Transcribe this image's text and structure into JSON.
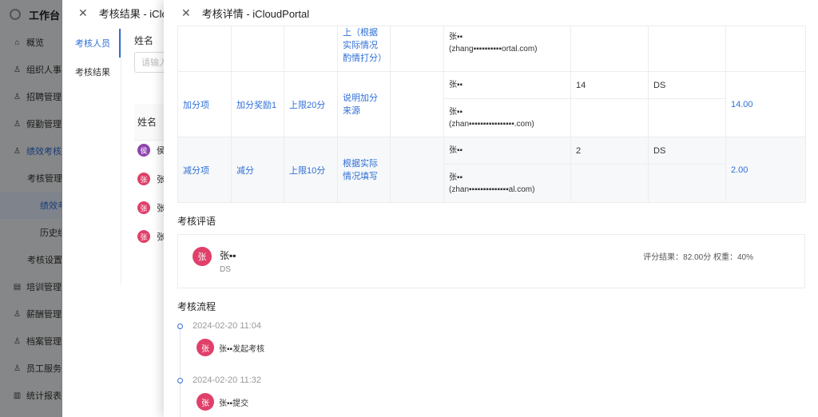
{
  "app": {
    "brand": "工作台",
    "nav": [
      {
        "label": "概览",
        "icon": "home-icon",
        "level": 0
      },
      {
        "label": "组织人事",
        "icon": "people-icon",
        "level": 0
      },
      {
        "label": "招聘管理",
        "icon": "people-icon",
        "level": 0
      },
      {
        "label": "假勤管理",
        "icon": "people-icon",
        "level": 0
      },
      {
        "label": "绩效考核",
        "icon": "people-icon",
        "level": 0
      },
      {
        "label": "考核管理",
        "icon": "",
        "level": 1
      },
      {
        "label": "绩效考核",
        "icon": "",
        "level": 2
      },
      {
        "label": "历史绩效",
        "icon": "",
        "level": 2
      },
      {
        "label": "考核设置",
        "icon": "",
        "level": 1
      },
      {
        "label": "培训管理",
        "icon": "book-icon",
        "level": 0
      },
      {
        "label": "薪酬管理",
        "icon": "people-icon",
        "level": 0
      },
      {
        "label": "档案管理",
        "icon": "people-icon",
        "level": 0
      },
      {
        "label": "员工服务",
        "icon": "people-icon",
        "level": 0
      },
      {
        "label": "统计报表",
        "icon": "chart-icon",
        "level": 0
      }
    ]
  },
  "drawer1": {
    "title": "考核结果 - iClou",
    "tabs": [
      "考核人员",
      "考核结果"
    ],
    "search_label": "姓名",
    "search_placeholder": "请输入",
    "column_name": "姓名",
    "rows": [
      {
        "avatar": "侯",
        "name": "侯",
        "color": "#8e44ad"
      },
      {
        "avatar": "张",
        "name": "张",
        "color": "#e0406a"
      },
      {
        "avatar": "张",
        "name": "张",
        "color": "#e0406a"
      },
      {
        "avatar": "张",
        "name": "张",
        "color": "#e0406a"
      }
    ]
  },
  "drawer2": {
    "title": "考核详情 - iCloudPortal",
    "table": {
      "top_row": {
        "c1": "",
        "c2": "",
        "c3": "",
        "c4": "上（根据实际情况酌情打分）",
        "user_name": "张▪▪",
        "user_email": "(zhang▪▪▪▪▪▪▪▪▪▪ortal.com)"
      },
      "bonus": {
        "category": "加分项",
        "item": "加分奖励1",
        "limit": "上限20分",
        "desc": "说明加分来源",
        "scorer1_name": "张▪▪",
        "scorer1_score": "14",
        "scorer1_dept": "DS",
        "scorer2_name": "张▪▪",
        "scorer2_email": "(zhan▪▪▪▪▪▪▪▪▪▪▪▪▪▪▪▪.com)",
        "total": "14.00"
      },
      "deduct": {
        "category": "减分项",
        "item": "减分",
        "limit": "上限10分",
        "desc": "根据实际情况填写",
        "scorer1_name": "张▪▪",
        "scorer1_score": "2",
        "scorer1_dept": "DS",
        "scorer2_name": "张▪▪",
        "scorer2_email": "(zhan▪▪▪▪▪▪▪▪▪▪▪▪▪▪al.com)",
        "total": "2.00"
      }
    },
    "comment_section_title": "考核评语",
    "comment": {
      "avatar": "张",
      "name": "张▪▪",
      "dept": "DS",
      "score_text": "评分结果：82.00分 权重：40%"
    },
    "flow_section_title": "考核流程",
    "flow": [
      {
        "time": "2024-02-20 11:04",
        "avatar": "张",
        "text": "张▪▪发起考核"
      },
      {
        "time": "2024-02-20 11:32",
        "avatar": "张",
        "text": "张▪▪提交"
      }
    ]
  }
}
